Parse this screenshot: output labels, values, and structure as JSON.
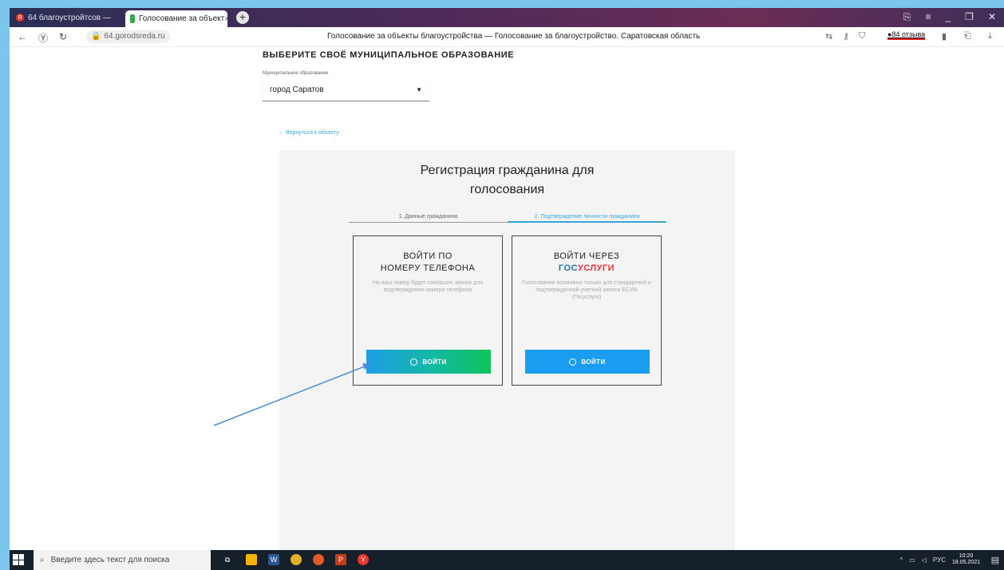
{
  "browser": {
    "tabs": [
      {
        "label": "64 благоустройтсов — ",
        "active": false
      },
      {
        "label": "Голосование за объект",
        "active": true
      }
    ],
    "new_tab_glyph": "+",
    "url": "64.gorodsreda.ru",
    "page_title": "Голосование за объекты благоустройства — Голосование за благоустройство. Саратовская область",
    "reviews": "84 отзыва"
  },
  "page": {
    "section_title": "ВЫБЕРИТЕ СВОЁ МУНИЦИПАЛЬНОЕ ОБРАЗОВАНИЕ",
    "select": {
      "label": "Муниципальное образование",
      "value": "город Саратов"
    },
    "back_link": "← Вернуться к объекту",
    "registration": {
      "title_line1": "Регистрация гражданина для",
      "title_line2": "голосования",
      "steps": [
        "1. Данные гражданина",
        "2. Подтверждение личности гражданина"
      ],
      "active_step": 2
    },
    "card_phone": {
      "title_line1": "ВОЙТИ ПО",
      "title_line2": "НОМЕРУ ТЕЛЕФОНА",
      "description": "На ваш номер будет совершен звонок для подтверждения номера телефона",
      "button_label": "ВОЙТИ"
    },
    "card_gosuslugi": {
      "title_line1": "ВОЙТИ ЧЕРЕЗ",
      "title_gos": "ГОС",
      "title_uslugi": "УСЛУГИ",
      "description": "Голосование возможно только для стандартной и подтвержденной учетной записи ЕСИА (Госуслуги)",
      "button_label": "ВОЙТИ"
    }
  },
  "taskbar": {
    "search_placeholder": "Введите здесь текст для поиска",
    "language": "РУС",
    "time": "10:20",
    "date": "18.05.2021"
  },
  "colors": {
    "accent_blue": "#1a9cf0",
    "gos_blue": "#1b6fb8",
    "gos_red": "#e3313b",
    "link_blue": "#3aa6d8",
    "phone_button_gradient": [
      "#1e9ee8",
      "#10c35c"
    ],
    "annotation_arrow": "#4a8fd6"
  }
}
